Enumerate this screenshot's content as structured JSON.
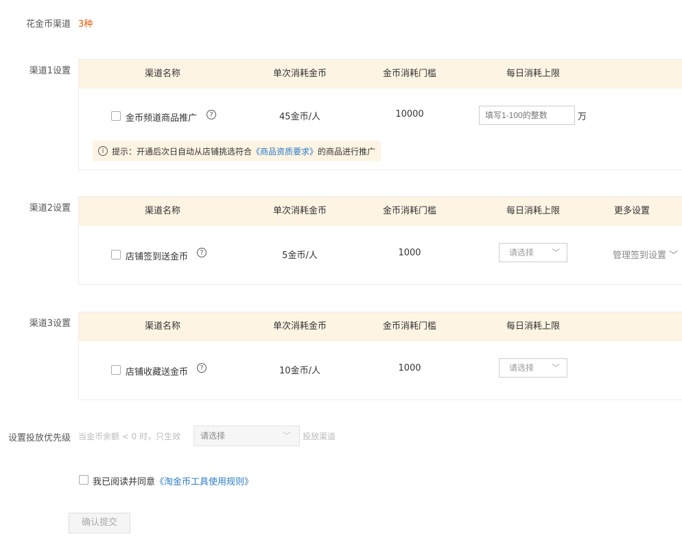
{
  "summary": {
    "label": "花金币渠道",
    "count": "3种"
  },
  "headers": {
    "name": "渠道名称",
    "cost": "单次消耗金币",
    "threshold": "金币消耗门槛",
    "daily_limit": "每日消耗上限",
    "more": "更多设置"
  },
  "channel1": {
    "label": "渠道1设置",
    "name": "金币频道商品推广",
    "cost": "45金币/人",
    "threshold": "10000",
    "input_placeholder": "填写1-100的整数",
    "unit": "万",
    "tip_prefix": "提示：开通后次日自动从店铺挑选符合",
    "tip_link": "《商品资质要求》",
    "tip_suffix": "的商品进行推广"
  },
  "channel2": {
    "label": "渠道2设置",
    "name": "店铺签到送金币",
    "cost": "5金币/人",
    "threshold": "1000",
    "select": "请选择",
    "more_link": "管理签到设置"
  },
  "channel3": {
    "label": "渠道3设置",
    "name": "店铺收藏送金币",
    "cost": "10金币/人",
    "threshold": "1000",
    "select": "请选择"
  },
  "priority": {
    "label": "设置投放优先级",
    "prefix": "当金币余额 < 0 时，只生效",
    "select": "请选择",
    "suffix": "投放渠道"
  },
  "agreement": {
    "text": "我已阅读并同意",
    "link": "《淘金币工具使用规则》"
  },
  "submit": {
    "label": "确认提交"
  },
  "icons": {
    "question": "?",
    "info": "i",
    "chevron": "﹀"
  }
}
